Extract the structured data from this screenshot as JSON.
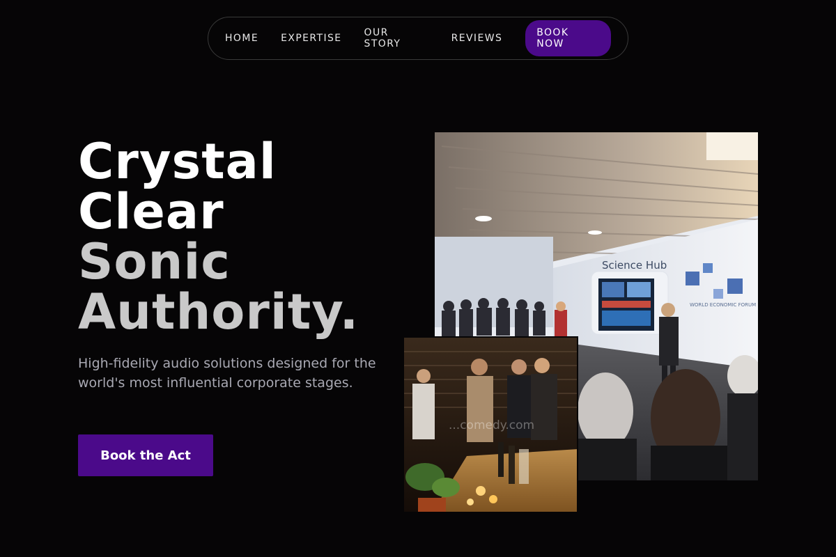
{
  "nav": {
    "items": [
      "HOME",
      "EXPERTISE",
      "OUR STORY",
      "REVIEWS"
    ],
    "book_label": "BOOK NOW"
  },
  "hero": {
    "title_line1": "Crystal",
    "title_line2": "Clear",
    "title_line3": "Sonic",
    "title_line4": "Authority.",
    "subtitle": "High-fidelity audio solutions designed for the world's most influential corporate stages.",
    "cta_label": "Book the Act"
  },
  "photos": {
    "main_sign": "Science Hub",
    "main_logo_text": "WORLD ECONOMIC FORUM",
    "small_watermark": "...comedy.com"
  },
  "colors": {
    "background": "#060506",
    "accent": "#4b0a8a",
    "title_primary": "#ffffff",
    "title_secondary": "#c9c9c9",
    "subtitle": "#a9a9b3"
  }
}
